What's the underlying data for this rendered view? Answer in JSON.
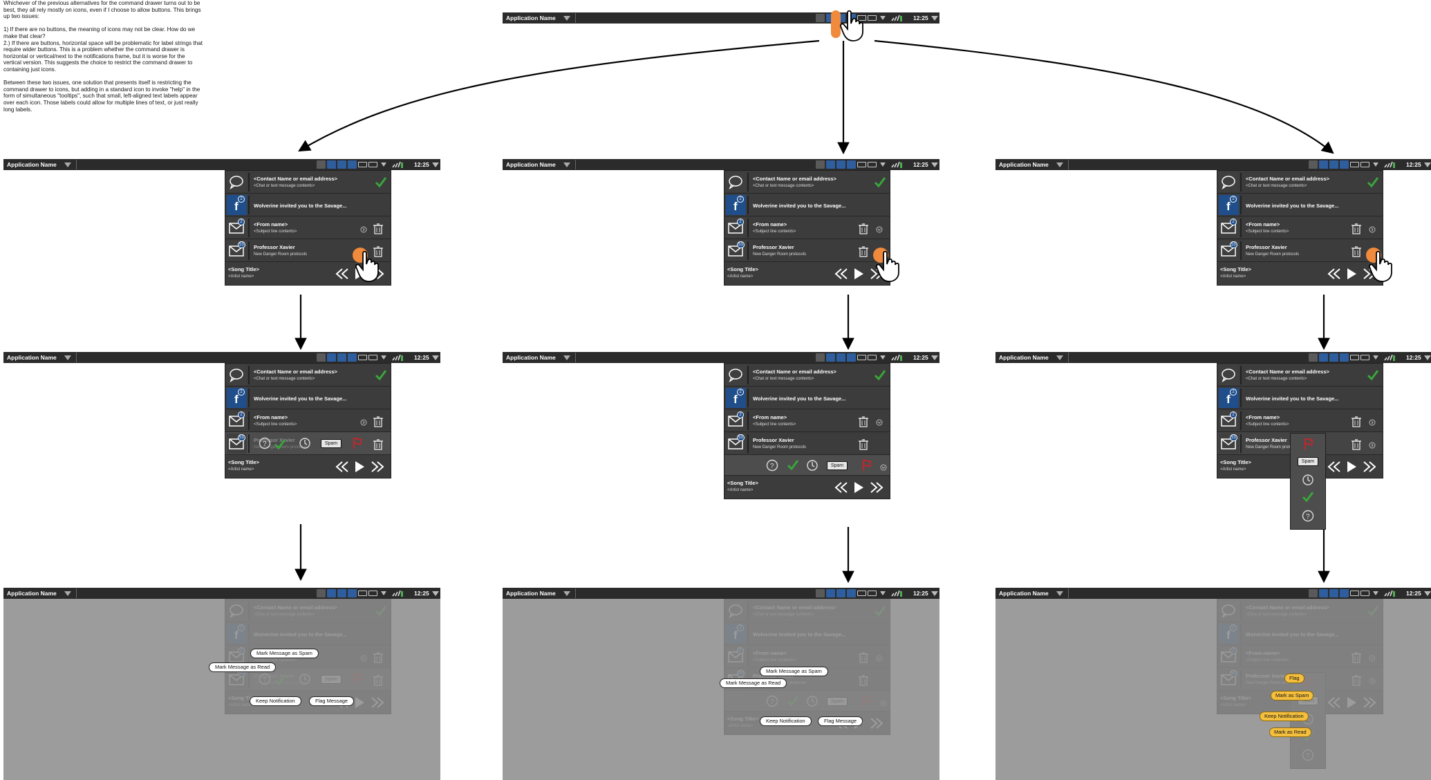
{
  "notes": {
    "p1": "Whichever of the previous alternatives for the command drawer turns out to be best, they all rely mostly on icons, even if I choose to allow buttons. This brings up two issues:",
    "p2": "1) If there are no buttons, the meaning of icons may not be clear. How do we make that clear?",
    "p3": "2.) If there are buttons, horizontal space will be problematic for label strings that require wider buttons. This is a problem whether the command drawer is horizontal or vertical/next to the notifications frame, but it is worse for the vertical version. This suggests the choice to restrict the command drawer to containing just icons.",
    "p4": "Between these two issues, one solution that presents itself is restricting the command drawer to icons, but adding in a standard icon to invoke \"help\" in the form of simultaneous \"tooltips\", such that small, left-aligned text labels appear over each icon. Those labels could allow for multiple lines of text, or just really long labels."
  },
  "statusbar": {
    "app_name": "Application Name",
    "time": "12:25"
  },
  "notifications": {
    "chat_title": "<Contact Name or email address>",
    "chat_sub": "<Chat or text message contents>",
    "fb_text": "Wolverine invited you to the Savage...",
    "fb_badge": "2",
    "mail_title": "<From name>",
    "mail_sub": "<Subject line contents>",
    "mail_badge": "2",
    "xavier_title": "Professor Xavier",
    "xavier_sub": "New Danger Room protocols",
    "xavier_badge": "53",
    "song_title": "<Song Title>",
    "artist": "<Artist name>"
  },
  "drawer": {
    "spam_label": "Spam"
  },
  "tooltips": {
    "mark_spam": "Mark Message as Spam",
    "mark_read": "Mark Message as Read",
    "keep": "Keep Notification",
    "flag": "Flag Message"
  },
  "yellow_tooltips": {
    "flag": "Flag",
    "mark_spam": "Mark as Spam",
    "keep": "Keep Notification",
    "mark_read": "Mark as Read"
  },
  "colors": {
    "bar": "#2b2b2b",
    "drawer": "#3c3c3c",
    "accent_blue": "#1f4e8a",
    "check_green": "#3aa53a",
    "flag_red": "#c0262c",
    "touch_orange": "#f08a3c",
    "tip_yellow": "#f4bf3e"
  }
}
